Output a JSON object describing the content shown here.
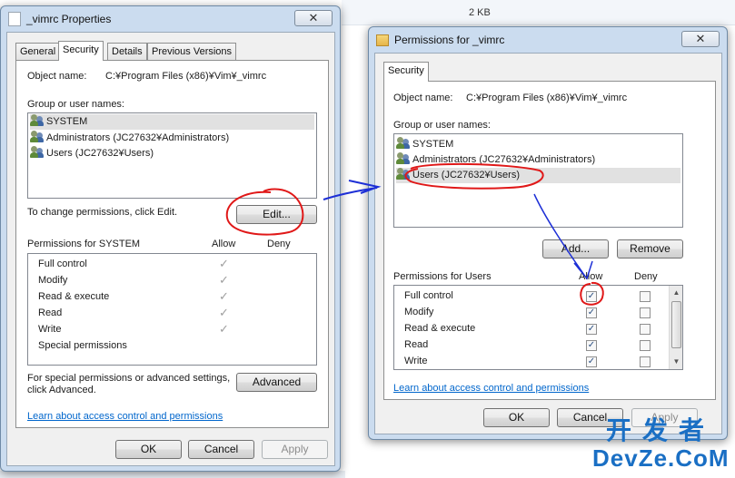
{
  "background": {
    "file_size": "2 KB"
  },
  "properties_window": {
    "title": "_vimrc Properties",
    "tabs": [
      "General",
      "Security",
      "Details",
      "Previous Versions"
    ],
    "active_tab": "Security",
    "object_name_label": "Object name:",
    "object_name_value": "C:¥Program Files (x86)¥Vim¥_vimrc",
    "group_label": "Group or user names:",
    "users": [
      "SYSTEM",
      "Administrators (JC27632¥Administrators)",
      "Users (JC27632¥Users)"
    ],
    "selected_user": "SYSTEM",
    "change_text": "To change permissions, click Edit.",
    "edit_button": "Edit...",
    "permissions_label": "Permissions for SYSTEM",
    "allow_header": "Allow",
    "deny_header": "Deny",
    "permissions": [
      {
        "name": "Full control",
        "allow": true,
        "deny": false
      },
      {
        "name": "Modify",
        "allow": true,
        "deny": false
      },
      {
        "name": "Read & execute",
        "allow": true,
        "deny": false
      },
      {
        "name": "Read",
        "allow": true,
        "deny": false
      },
      {
        "name": "Write",
        "allow": true,
        "deny": false
      },
      {
        "name": "Special permissions",
        "allow": false,
        "deny": false
      }
    ],
    "special_text_line1": "For special permissions or advanced settings,",
    "special_text_line2": "click Advanced.",
    "advanced_button": "Advanced",
    "learn_link": "Learn about access control and permissions",
    "ok_button": "OK",
    "cancel_button": "Cancel",
    "apply_button": "Apply"
  },
  "permissions_window": {
    "title": "Permissions for _vimrc",
    "tab": "Security",
    "object_name_label": "Object name:",
    "object_name_value": "C:¥Program Files (x86)¥Vim¥_vimrc",
    "group_label": "Group or user names:",
    "users": [
      "SYSTEM",
      "Administrators (JC27632¥Administrators)",
      "Users (JC27632¥Users)"
    ],
    "selected_user": "Users (JC27632¥Users)",
    "add_button": "Add...",
    "remove_button": "Remove",
    "permissions_label": "Permissions for Users",
    "allow_header": "Allow",
    "deny_header": "Deny",
    "permissions": [
      {
        "name": "Full control",
        "allow": true,
        "deny": false
      },
      {
        "name": "Modify",
        "allow": true,
        "deny": false
      },
      {
        "name": "Read & execute",
        "allow": true,
        "deny": false
      },
      {
        "name": "Read",
        "allow": true,
        "deny": false
      },
      {
        "name": "Write",
        "allow": true,
        "deny": false
      }
    ],
    "learn_link": "Learn about access control and permissions",
    "ok_button": "OK",
    "cancel_button": "Cancel",
    "apply_button": "Apply"
  },
  "annotation_colors": {
    "circle": "#e01818",
    "arrow": "#1d2fd6"
  },
  "watermark": {
    "line1": "开发者",
    "line2": "DevZe.CoM",
    "color": "#1a6fc4"
  }
}
